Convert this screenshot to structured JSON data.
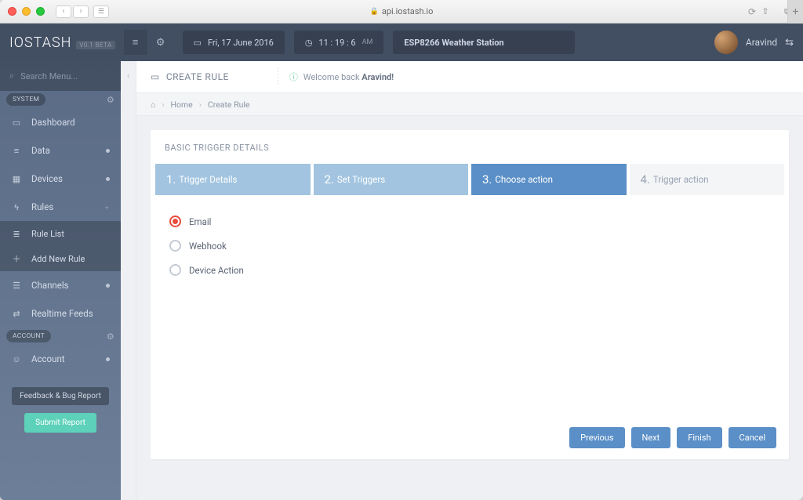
{
  "browser": {
    "url": "api.iostash.io"
  },
  "brand": {
    "name": "IOSTASH",
    "badge": "V0.1 BETA"
  },
  "topbar": {
    "date": "Fri, 17 June 2016",
    "time": "11 : 19 : 6",
    "time_suffix": "AM",
    "device": "ESP8266 Weather Station",
    "user": "Aravind"
  },
  "sidebar": {
    "search_placeholder": "Search Menu...",
    "sections": {
      "system": "SYSTEM",
      "account": "ACCOUNT"
    },
    "items": {
      "dashboard": "Dashboard",
      "data": "Data",
      "devices": "Devices",
      "rules": "Rules",
      "rule_list": "Rule List",
      "add_rule": "Add New Rule",
      "channels": "Channels",
      "realtime": "Realtime Feeds",
      "account": "Account"
    },
    "feedback": "Feedback & Bug Report",
    "submit": "Submit Report"
  },
  "page": {
    "title": "CREATE RULE",
    "welcome_prefix": "Welcome back ",
    "welcome_name": "Aravind!",
    "crumb_home": "Home",
    "crumb_current": "Create Rule"
  },
  "card": {
    "title": "BASIC TRIGGER DETAILS",
    "steps": [
      {
        "num": "1.",
        "label": "Trigger Details"
      },
      {
        "num": "2.",
        "label": "Set Triggers"
      },
      {
        "num": "3.",
        "label": "Choose action"
      },
      {
        "num": "4.",
        "label": "Trigger action"
      }
    ],
    "options": [
      {
        "label": "Email",
        "selected": true
      },
      {
        "label": "Webhook",
        "selected": false
      },
      {
        "label": "Device Action",
        "selected": false
      }
    ],
    "buttons": {
      "previous": "Previous",
      "next": "Next",
      "finish": "Finish",
      "cancel": "Cancel"
    }
  }
}
